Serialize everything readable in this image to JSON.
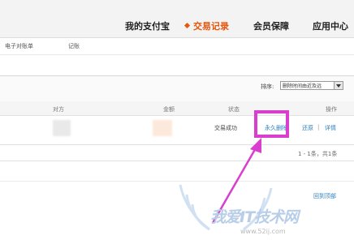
{
  "nav": {
    "items": [
      {
        "label": "我的支付宝",
        "active": false
      },
      {
        "label": "交易记录",
        "active": true
      },
      {
        "label": "会员保障",
        "active": false
      },
      {
        "label": "应用中心",
        "active": false
      }
    ]
  },
  "subnav": {
    "items": [
      "电子对账单",
      "记账"
    ]
  },
  "sort": {
    "label": "排序:",
    "value": "删除时间由近及远"
  },
  "table": {
    "headers": {
      "party": "对方",
      "amount": "金额",
      "status": "状态",
      "action": "操作"
    },
    "rows": [
      {
        "status": "交易成功",
        "actions": {
          "delete": "永久删除",
          "restore": "还原",
          "details": "详情"
        }
      }
    ]
  },
  "pager": {
    "summary": "1 - 1条，共1条"
  },
  "back_to_top": "回到顶部",
  "watermark": {
    "text": "我爱IT技术网",
    "url": "www.52ij.com"
  },
  "colors": {
    "accent": "#e8550b",
    "link": "#2b7fc0",
    "highlight": "#d93ecf"
  }
}
